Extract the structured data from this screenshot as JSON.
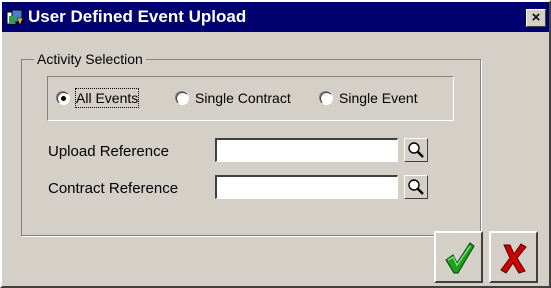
{
  "window": {
    "title": "User Defined Event Upload",
    "close_glyph": "×",
    "colors": {
      "titlebar": "#00006f",
      "face": "#d4d0c8"
    }
  },
  "activity_selection": {
    "legend": "Activity Selection",
    "options": [
      {
        "label": "All Events",
        "selected": true
      },
      {
        "label": "Single Contract",
        "selected": false
      },
      {
        "label": "Single Event",
        "selected": false
      }
    ]
  },
  "fields": {
    "upload_reference": {
      "label": "Upload Reference",
      "value": "",
      "lov_icon": "magnifier-icon"
    },
    "contract_reference": {
      "label": "Contract Reference",
      "value": "",
      "lov_icon": "magnifier-icon"
    }
  },
  "actions": {
    "ok_icon": "green-checkmark-icon",
    "cancel_icon": "red-x-icon",
    "colors": {
      "ok": "#1ea01e",
      "cancel": "#d00000"
    }
  }
}
